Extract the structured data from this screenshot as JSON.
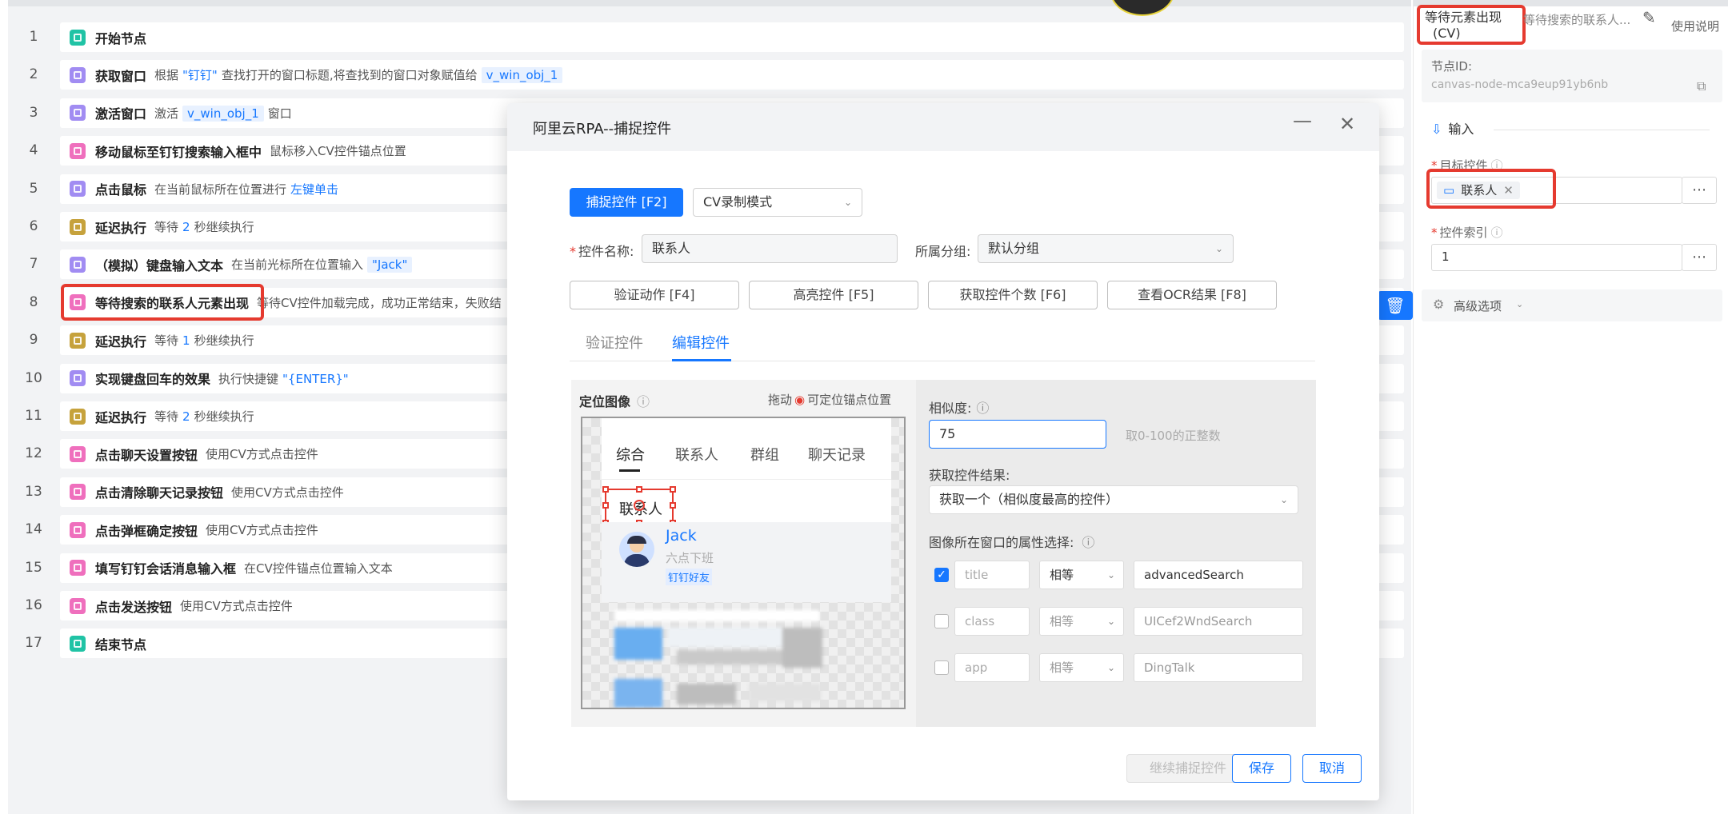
{
  "workflow": {
    "rows": [
      {
        "num": "1",
        "title": "开始节点",
        "icon_color": "teal",
        "icon": "start-node-icon",
        "desc": []
      },
      {
        "num": "2",
        "title": "获取窗口",
        "icon_color": "purple",
        "icon": "window-icon",
        "desc": [
          {
            "t": "根据",
            "s": "n"
          },
          {
            "t": "\"钉钉\"",
            "s": "hl"
          },
          {
            "t": "查找打开的窗口标题,将查找到的窗口对象赋值给",
            "s": "n"
          },
          {
            "t": "v_win_obj_1",
            "s": "tag"
          }
        ]
      },
      {
        "num": "3",
        "title": "激活窗口",
        "icon_color": "purple",
        "icon": "window-icon",
        "desc": [
          {
            "t": "激活",
            "s": "n"
          },
          {
            "t": "v_win_obj_1",
            "s": "tag"
          },
          {
            "t": "窗口",
            "s": "n"
          }
        ]
      },
      {
        "num": "4",
        "title": "移动鼠标至钉钉搜索输入框中",
        "icon_color": "pink",
        "icon": "image-icon",
        "desc": [
          {
            "t": "鼠标移入CV控件锚点位置",
            "s": "n"
          }
        ]
      },
      {
        "num": "5",
        "title": "点击鼠标",
        "icon_color": "purple",
        "icon": "mouse-icon",
        "desc": [
          {
            "t": "在当前鼠标所在位置进行",
            "s": "n"
          },
          {
            "t": "左键单击",
            "s": "hl"
          }
        ]
      },
      {
        "num": "6",
        "title": "延迟执行",
        "icon_color": "yellow",
        "icon": "delay-icon",
        "desc": [
          {
            "t": "等待",
            "s": "n"
          },
          {
            "t": "2",
            "s": "hl"
          },
          {
            "t": "秒继续执行",
            "s": "n"
          }
        ]
      },
      {
        "num": "7",
        "title": "（模拟）键盘输入文本",
        "icon_color": "purple",
        "icon": "keyboard-icon",
        "desc": [
          {
            "t": "在当前光标所在位置输入",
            "s": "n"
          },
          {
            "t": "\"Jack\"",
            "s": "tag"
          }
        ]
      },
      {
        "num": "8",
        "title": "等待搜索的联系人元素出现",
        "icon_color": "pink",
        "icon": "image-icon",
        "desc": [
          {
            "t": "等待CV控件加载完成，成功正常结束，失败结",
            "s": "n"
          }
        ]
      },
      {
        "num": "9",
        "title": "延迟执行",
        "icon_color": "yellow",
        "icon": "delay-icon",
        "desc": [
          {
            "t": "等待",
            "s": "n"
          },
          {
            "t": "1",
            "s": "hl"
          },
          {
            "t": "秒继续执行",
            "s": "n"
          }
        ]
      },
      {
        "num": "10",
        "title": "实现键盘回车的效果",
        "icon_color": "purple",
        "icon": "keyboard-icon",
        "desc": [
          {
            "t": "执行快捷键",
            "s": "n"
          },
          {
            "t": "\"{ENTER}\"",
            "s": "hl"
          }
        ]
      },
      {
        "num": "11",
        "title": "延迟执行",
        "icon_color": "yellow",
        "icon": "delay-icon",
        "desc": [
          {
            "t": "等待",
            "s": "n"
          },
          {
            "t": "2",
            "s": "hl"
          },
          {
            "t": "秒继续执行",
            "s": "n"
          }
        ]
      },
      {
        "num": "12",
        "title": "点击聊天设置按钮",
        "icon_color": "pink",
        "icon": "image-icon",
        "desc": [
          {
            "t": "使用CV方式点击控件",
            "s": "n"
          }
        ]
      },
      {
        "num": "13",
        "title": "点击清除聊天记录按钮",
        "icon_color": "pink",
        "icon": "image-icon",
        "desc": [
          {
            "t": "使用CV方式点击控件",
            "s": "n"
          }
        ]
      },
      {
        "num": "14",
        "title": "点击弹框确定按钮",
        "icon_color": "pink",
        "icon": "image-icon",
        "desc": [
          {
            "t": "使用CV方式点击控件",
            "s": "n"
          }
        ]
      },
      {
        "num": "15",
        "title": "填写钉钉会话消息输入框",
        "icon_color": "pink",
        "icon": "image-icon",
        "desc": [
          {
            "t": "在CV控件锚点位置输入文本",
            "s": "n"
          }
        ]
      },
      {
        "num": "16",
        "title": "点击发送按钮",
        "icon_color": "pink",
        "icon": "image-icon",
        "desc": [
          {
            "t": "使用CV方式点击控件",
            "s": "n"
          }
        ]
      },
      {
        "num": "17",
        "title": "结束节点",
        "icon_color": "teal",
        "icon": "end-node-icon",
        "desc": []
      }
    ]
  },
  "panel": {
    "node_type": "等待元素出现",
    "node_type_sub": "(CV)",
    "node_name": "等待搜索的联系人...",
    "help_label": "使用说明",
    "node_id_label": "节点ID:",
    "node_id_value": "canvas-node-mca9eup91yb6nb",
    "input_section": "输入",
    "target_label": "目标控件",
    "target_value": "联系人",
    "index_label": "控件索引",
    "index_value": "1",
    "advanced_label": "高级选项"
  },
  "dialog": {
    "title": "阿里云RPA--捕捉控件",
    "capture_btn": "捕捉控件 [F2]",
    "mode_value": "CV录制模式",
    "name_label": "控件名称:",
    "name_value": "联系人",
    "group_label": "所属分组:",
    "group_value": "默认分组",
    "actions": [
      "验证动作 [F4]",
      "高亮控件 [F5]",
      "获取控件个数 [F6]",
      "查看OCR结果 [F8]"
    ],
    "tabs": [
      "验证控件",
      "编辑控件"
    ],
    "locate_image_label": "定位图像",
    "drag_hint_prefix": "拖动",
    "drag_hint_suffix": "可定位锚点位置",
    "similarity_label": "相似度:",
    "similarity_value": "75",
    "similarity_hint": "取0-100的正整数",
    "result_label": "获取控件结果:",
    "result_value": "获取一个（相似度最高的控件）",
    "attr_label": "图像所在窗口的属性选择:",
    "attrs": [
      {
        "name": "title",
        "op": "相等",
        "value": "advancedSearch",
        "checked": true
      },
      {
        "name": "class",
        "op": "相等",
        "value": "UICef2WndSearch",
        "checked": false
      },
      {
        "name": "app",
        "op": "相等",
        "value": "DingTalk",
        "checked": false
      }
    ],
    "continue_btn": "继续捕捉控件",
    "save_btn": "保存",
    "cancel_btn": "取消",
    "preview": {
      "tabs": [
        "综合",
        "联系人",
        "群组",
        "聊天记录"
      ],
      "anchor_text": "联系人",
      "contact_name": "Jack",
      "contact_status": "六点下班",
      "contact_tag": "钉钉好友"
    }
  }
}
